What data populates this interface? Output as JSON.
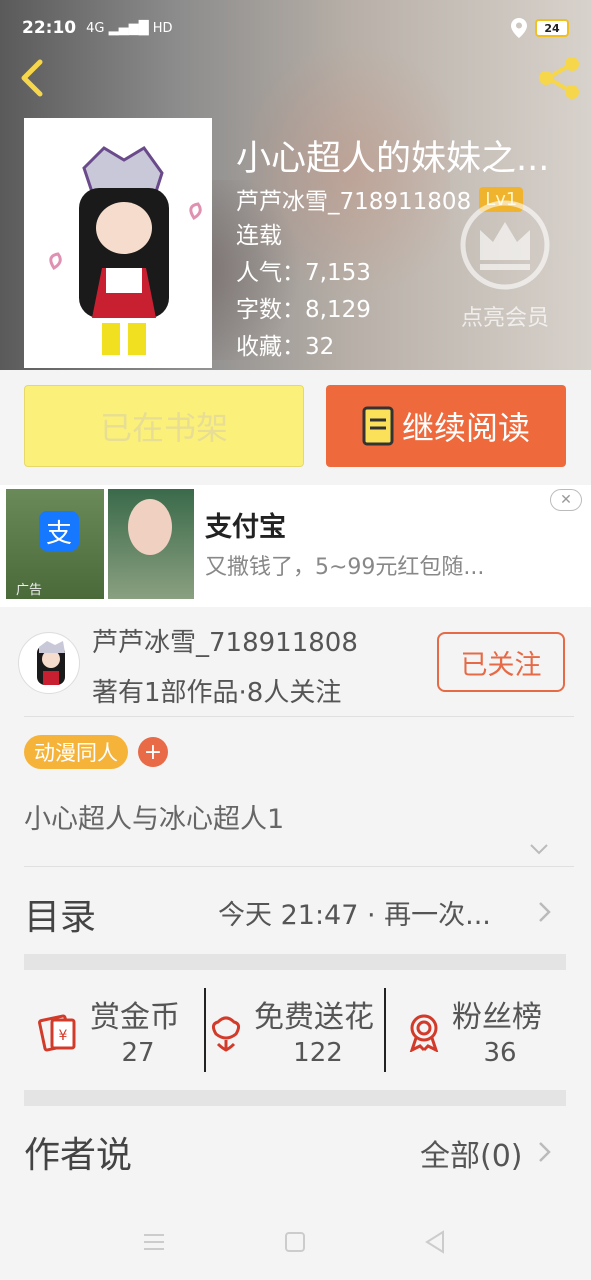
{
  "status": {
    "time": "22:10",
    "network": "4G",
    "signal": "HD",
    "battery": "24"
  },
  "header": {
    "back_icon": "back-chevron-icon",
    "share_icon": "share-icon"
  },
  "book": {
    "title": "小心超人的妹妹之...",
    "author": "芦芦冰雪_718911808",
    "level": "Lv1",
    "status": "连载",
    "popularity_label": "人气：",
    "popularity": "7,153",
    "words_label": "字数：",
    "words": "8,129",
    "favorites_label": "收藏：",
    "favorites": "32"
  },
  "vip": {
    "label": "点亮会员",
    "icon": "crown-icon"
  },
  "actions": {
    "shelf_label": "已在书架",
    "read_label": "继续阅读",
    "book_icon": "book-icon"
  },
  "ad": {
    "title": "支付宝",
    "description": "又撒钱了，5~99元红包随...",
    "ad_label": "广告",
    "logo_char": "支",
    "close": "✕"
  },
  "author": {
    "name": "芦芦冰雪_718911808",
    "works": "著有1部作品·8人关注",
    "follow_label": "已关注"
  },
  "tags": {
    "items": [
      "动漫同人"
    ],
    "add": "+"
  },
  "description": "小心超人与冰心超人1",
  "toc": {
    "title": "目录",
    "latest": "今天 21:47 · 再一次..."
  },
  "stats": [
    {
      "label": "赏金币",
      "value": "27",
      "icon": "coin-envelope-icon"
    },
    {
      "label": "免费送花",
      "value": "122",
      "icon": "flower-icon"
    },
    {
      "label": "粉丝榜",
      "value": "36",
      "icon": "medal-icon"
    }
  ],
  "author_says": {
    "title": "作者说",
    "all_label": "全部(0)"
  },
  "colors": {
    "accent": "#ee6a3c",
    "shelf": "#fbf17a",
    "tag": "#f5b33a",
    "follow": "#e66a46"
  }
}
